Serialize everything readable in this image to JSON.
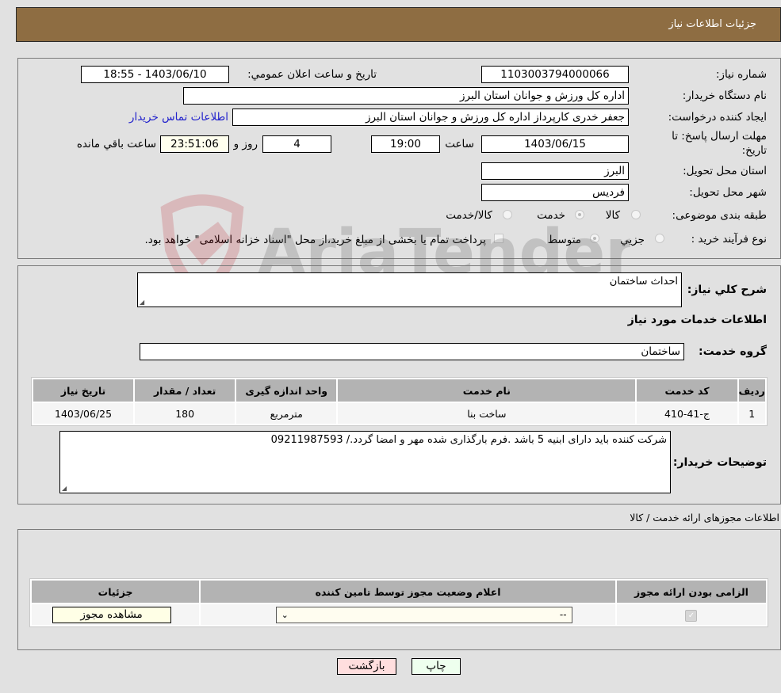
{
  "header": {
    "title": "جزئيات اطلاعات نياز"
  },
  "details": {
    "need_number_label": "شماره نياز:",
    "need_number": "1103003794000066",
    "announce_label": "تاريخ و ساعت اعلان عمومي:",
    "announce_value": "1403/06/10 - 18:55",
    "buyer_org_label": "نام دستگاه خريدار:",
    "buyer_org": "اداره کل ورزش و جوانان استان البرز",
    "creator_label": "ايجاد کننده درخواست:",
    "creator": "جعفر خدری کارپرداز اداره کل ورزش و جوانان استان البرز",
    "contact_link": "اطلاعات تماس خريدار",
    "deadline_label_line1": "مهلت ارسال پاسخ: تا",
    "deadline_label_line2": "تاريخ:",
    "deadline_date": "1403/06/15",
    "time_label": "ساعت",
    "deadline_time": "19:00",
    "days_value": "4",
    "days_label": "روز و",
    "remaining_time": "23:51:06",
    "remaining_label": "ساعت باقي مانده",
    "province_label": "استان محل تحويل:",
    "province": "البرز",
    "city_label": "شهر محل تحويل:",
    "city": "فرديس",
    "category_label": "طبقه بندی موضوعی:",
    "category_options": [
      {
        "label": "کالا",
        "selected": false
      },
      {
        "label": "خدمت",
        "selected": true
      },
      {
        "label": "کالا/خدمت",
        "selected": false
      }
    ],
    "process_label": "نوع فرآيند خريد :",
    "process_options": [
      {
        "label": "جزيي",
        "selected": false
      },
      {
        "label": "متوسط",
        "selected": true
      }
    ],
    "treasury_note": "پرداخت تمام يا بخشی از مبلغ خريد،از محل \"اسناد خزانه اسلامی\" خواهد بود.",
    "treasury_checked": false
  },
  "services": {
    "summary_label": "شرح کلي نياز:",
    "summary": "احداث ساختمان",
    "section_title": "اطلاعات خدمات مورد نياز",
    "group_label": "گروه خدمت:",
    "group": "ساختمان",
    "table": {
      "headers": [
        "رديف",
        "کد خدمت",
        "نام خدمت",
        "واحد اندازه گيری",
        "تعداد / مقدار",
        "تاريخ نياز"
      ],
      "rows": [
        [
          "1",
          "ج-41-410",
          "ساخت بنا",
          "مترمربع",
          "180",
          "1403/06/25"
        ]
      ]
    },
    "buyer_notes_label": "توضيحات خريدار:",
    "buyer_notes": "شرکت کننده بايد دارای ابنيه 5 باشد .فرم بارگذاری شده مهر و امضا گردد./ 09211987593"
  },
  "permits": {
    "title": "اطلاعات مجوزهای ارائه خدمت / کالا",
    "headers": [
      "الزامی بودن ارائه مجوز",
      "اعلام وضعيت مجوز توسط تامين کننده",
      "جزئيات"
    ],
    "row": {
      "required": true,
      "status_selected": "--",
      "details_button": "مشاهده مجوز"
    }
  },
  "footer": {
    "print_button": "چاپ",
    "back_button": "بازگشت"
  },
  "watermark": {
    "text": "AriaTender.neT"
  }
}
